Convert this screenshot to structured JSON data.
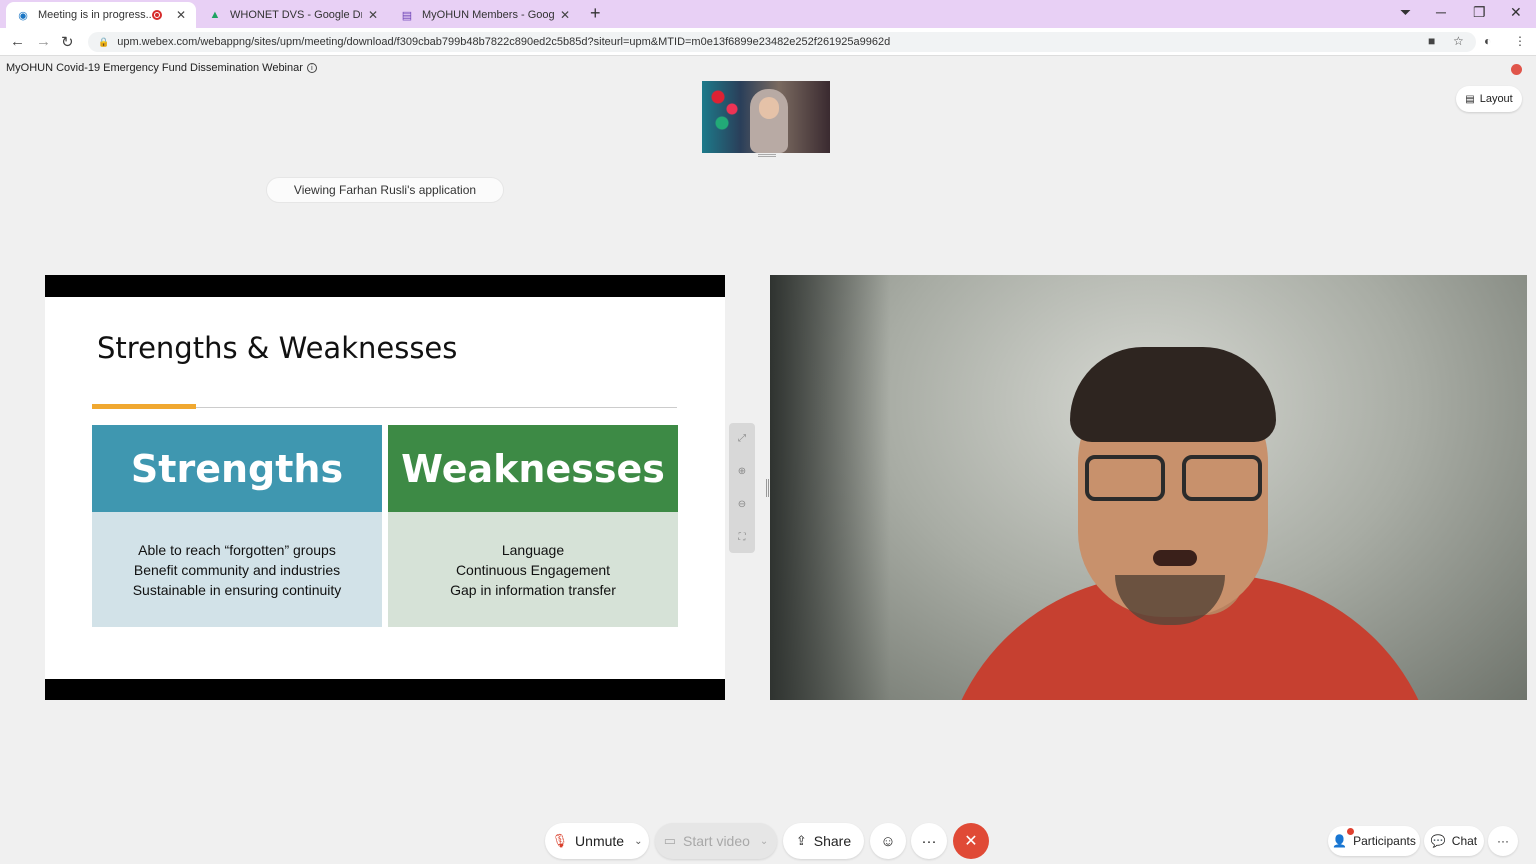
{
  "browser": {
    "tabs": [
      {
        "title": "Meeting is in progress...",
        "active": true
      },
      {
        "title": "WHONET DVS - Google Drive",
        "active": false
      },
      {
        "title": "MyOHUN Members - Google For",
        "active": false
      }
    ],
    "url": "upm.webex.com/webappng/sites/upm/meeting/download/f309cbab799b48b7822c890ed2c5b85d?siteurl=upm&MTID=m0e13f6899e23482e252f261925a9962d",
    "new_tab_icon": "+",
    "window_controls": {
      "minimize": "─",
      "restore": "❐",
      "close": "✕"
    }
  },
  "meeting": {
    "title": "MyOHUN Covid-19 Emergency Fund Dissemination Webinar",
    "layout_label": "Layout",
    "viewing_text": "Viewing Farhan Rusli's application"
  },
  "slide": {
    "title": "Strengths & Weaknesses",
    "strengths": {
      "heading": "Strengths",
      "items": [
        "Able to reach “forgotten” groups",
        "Benefit community and industries",
        "Sustainable in ensuring continuity"
      ]
    },
    "weaknesses": {
      "heading": "Weaknesses",
      "items": [
        "Language",
        "Continuous Engagement",
        "Gap in information transfer"
      ]
    }
  },
  "controls": {
    "unmute": "Unmute",
    "start_video": "Start video",
    "share": "Share",
    "participants": "Participants",
    "chat": "Chat",
    "more": "···"
  },
  "colors": {
    "strengths_head": "#3f97b0",
    "weaknesses_head": "#3d8a45",
    "accent": "#f0a830",
    "end_call": "#e04a36",
    "tabbar": "#e8d0f5"
  }
}
